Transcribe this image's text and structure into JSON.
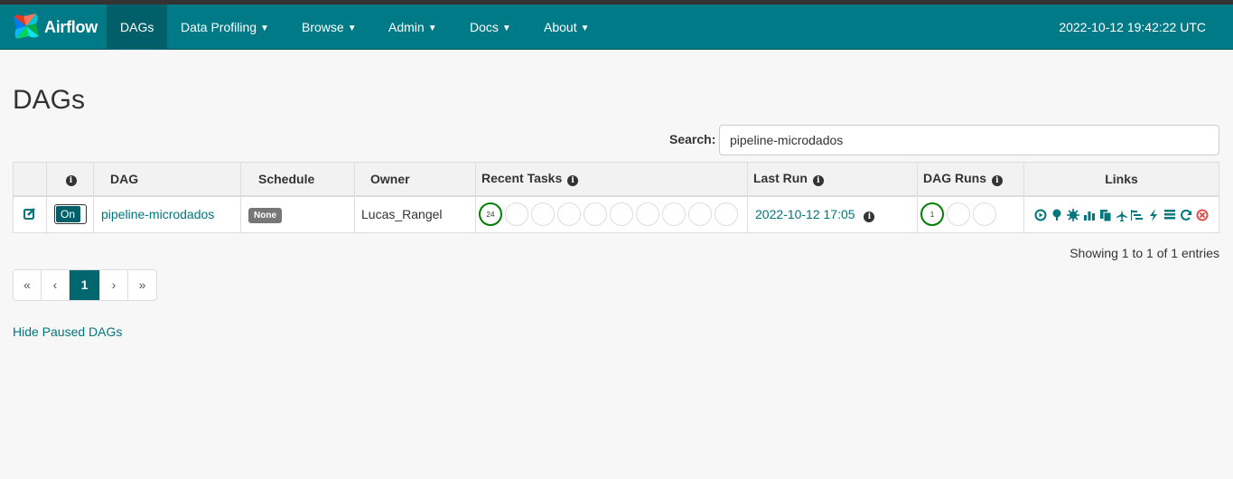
{
  "brand": {
    "name": "Airflow"
  },
  "nav": {
    "dags": "DAGs",
    "data_profiling": "Data Profiling",
    "browse": "Browse",
    "admin": "Admin",
    "docs": "Docs",
    "about": "About",
    "clock": "2022-10-12 19:42:22 UTC"
  },
  "page": {
    "title": "DAGs"
  },
  "search": {
    "label": "Search:",
    "value": "pipeline-microdados"
  },
  "table": {
    "headers": {
      "dag": "DAG",
      "schedule": "Schedule",
      "owner": "Owner",
      "recent_tasks": "Recent Tasks",
      "last_run": "Last Run",
      "dag_runs": "DAG Runs",
      "links": "Links"
    },
    "rows": [
      {
        "toggle": "On",
        "dag_id": "pipeline-microdados",
        "schedule": "None",
        "owner": "Lucas_Rangel",
        "recent_tasks_success_count": "24",
        "last_run": "2022-10-12 17:05",
        "dag_runs_success_count": "1"
      }
    ]
  },
  "pagination": {
    "showing": "Showing 1 to 1 of 1 entries",
    "first": "«",
    "prev": "‹",
    "current": "1",
    "next": "›",
    "last": "»"
  },
  "footer_links": {
    "hide_paused": "Hide Paused DAGs"
  },
  "colors": {
    "navbar": "#007A87",
    "accent": "#00767d",
    "success": "#008000",
    "delete": "#d9534f"
  }
}
